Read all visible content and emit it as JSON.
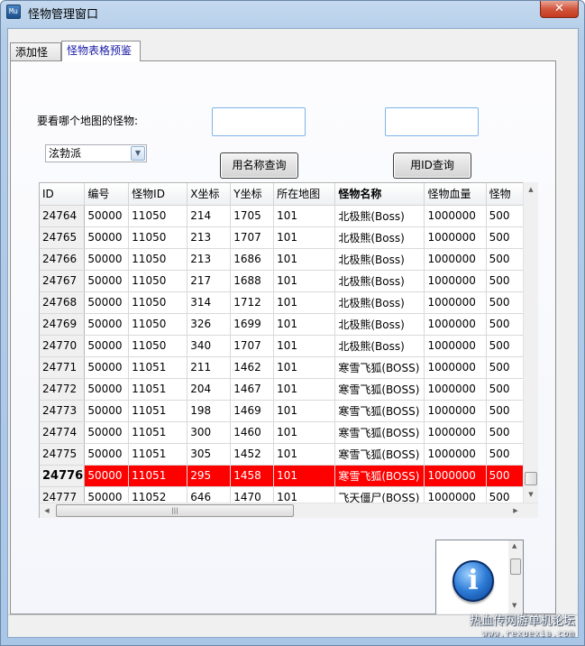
{
  "window": {
    "title": "怪物管理窗口",
    "app_icon_text": "Mu",
    "close_symbol": "✕"
  },
  "tabs": [
    {
      "label": "添加怪物",
      "active": false
    },
    {
      "label": "怪物表格预鉴",
      "active": true
    }
  ],
  "form": {
    "map_label": "要看哪个地图的怪物:",
    "map_select_value": "泫勃派",
    "name_input_value": "",
    "id_input_value": "",
    "query_by_name_label": "用名称查询",
    "query_by_id_label": "用ID查询"
  },
  "grid": {
    "columns": [
      "ID",
      "编号",
      "怪物ID",
      "X坐标",
      "Y坐标",
      "所在地图",
      "怪物名称",
      "怪物血量",
      "怪物"
    ],
    "bold_column_index": 6,
    "selected_row_index": 12,
    "rows": [
      [
        "24764",
        "50000",
        "11050",
        "214",
        "1705",
        "101",
        "北极熊(Boss)",
        "1000000",
        "500"
      ],
      [
        "24765",
        "50000",
        "11050",
        "213",
        "1707",
        "101",
        "北极熊(Boss)",
        "1000000",
        "500"
      ],
      [
        "24766",
        "50000",
        "11050",
        "213",
        "1686",
        "101",
        "北极熊(Boss)",
        "1000000",
        "500"
      ],
      [
        "24767",
        "50000",
        "11050",
        "217",
        "1688",
        "101",
        "北极熊(Boss)",
        "1000000",
        "500"
      ],
      [
        "24768",
        "50000",
        "11050",
        "314",
        "1712",
        "101",
        "北极熊(Boss)",
        "1000000",
        "500"
      ],
      [
        "24769",
        "50000",
        "11050",
        "326",
        "1699",
        "101",
        "北极熊(Boss)",
        "1000000",
        "500"
      ],
      [
        "24770",
        "50000",
        "11050",
        "340",
        "1707",
        "101",
        "北极熊(Boss)",
        "1000000",
        "500"
      ],
      [
        "24771",
        "50000",
        "11051",
        "211",
        "1462",
        "101",
        "寒雪飞狐(BOSS)",
        "1000000",
        "500"
      ],
      [
        "24772",
        "50000",
        "11051",
        "204",
        "1467",
        "101",
        "寒雪飞狐(BOSS)",
        "1000000",
        "500"
      ],
      [
        "24773",
        "50000",
        "11051",
        "198",
        "1469",
        "101",
        "寒雪飞狐(BOSS)",
        "1000000",
        "500"
      ],
      [
        "24774",
        "50000",
        "11051",
        "300",
        "1460",
        "101",
        "寒雪飞狐(BOSS)",
        "1000000",
        "500"
      ],
      [
        "24775",
        "50000",
        "11051",
        "305",
        "1452",
        "101",
        "寒雪飞狐(BOSS)",
        "1000000",
        "500"
      ],
      [
        "24776",
        "50000",
        "11051",
        "295",
        "1458",
        "101",
        "寒雪飞狐(BOSS)",
        "1000000",
        "500"
      ],
      [
        "24777",
        "50000",
        "11052",
        "646",
        "1470",
        "101",
        "飞天僵尸(BOSS)",
        "1000000",
        "500"
      ]
    ],
    "selected_row_color": "#ff0000",
    "hscroll_thumb_glyph": "|||"
  },
  "picture": {
    "icon": "info-icon",
    "glyph": "i"
  },
  "watermark": {
    "line1": "热血传网游单机论坛",
    "line2": "www.rexuexia.com"
  }
}
